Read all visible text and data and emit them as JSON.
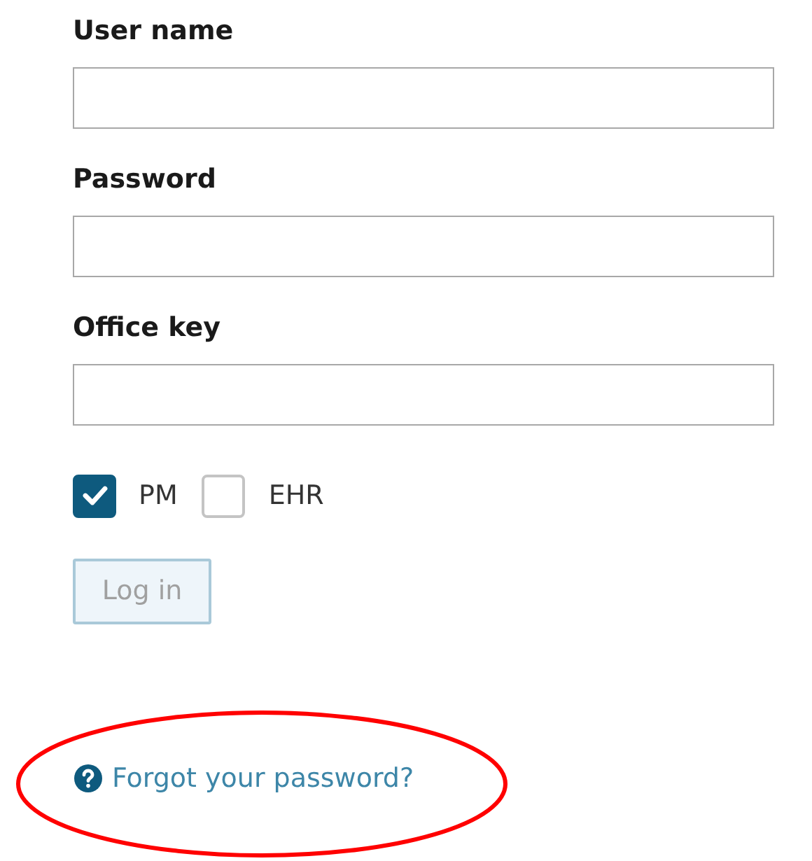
{
  "fields": [
    {
      "label": "User name"
    },
    {
      "label": "Password"
    },
    {
      "label": "Office key"
    }
  ],
  "products": [
    {
      "label": "PM",
      "checked": true
    },
    {
      "label": "EHR",
      "checked": false
    }
  ],
  "login_button": {
    "label": "Log in",
    "disabled": true
  },
  "forgot_link": {
    "label": "Forgot your password?",
    "highlighted": true
  }
}
